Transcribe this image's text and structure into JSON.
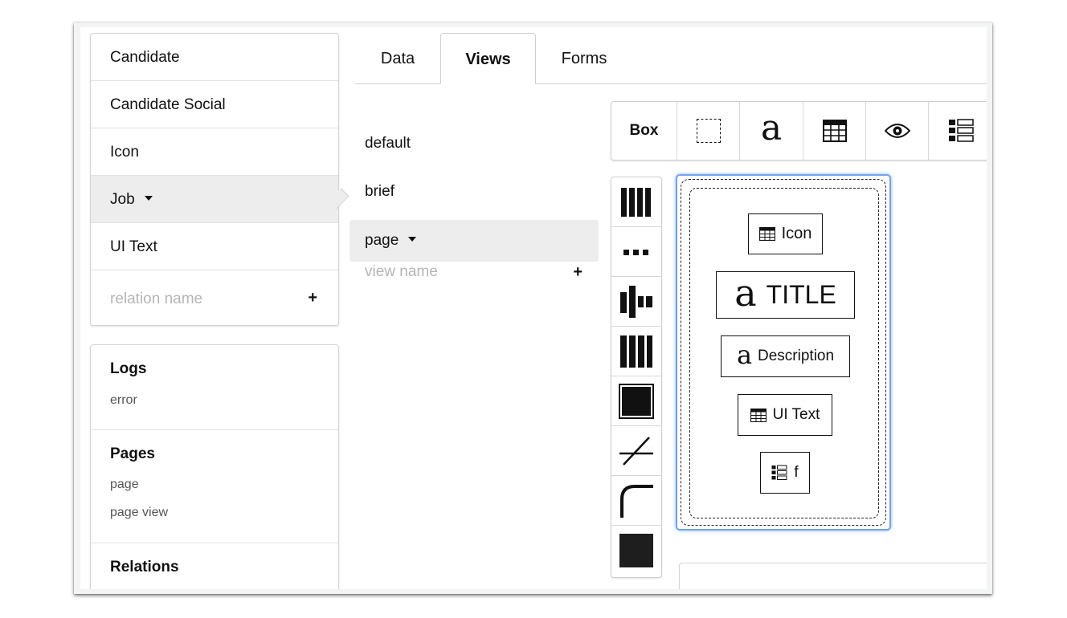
{
  "relations": {
    "items": [
      {
        "label": "Candidate"
      },
      {
        "label": "Candidate Social"
      },
      {
        "label": "Icon"
      },
      {
        "label": "Job"
      },
      {
        "label": "UI Text"
      }
    ],
    "selected": "Job",
    "add_placeholder": "relation name",
    "add_button": "+"
  },
  "meta": {
    "logs": {
      "title": "Logs",
      "items": [
        "error"
      ]
    },
    "pages": {
      "title": "Pages",
      "items": [
        "page",
        "page view"
      ]
    },
    "relations_title": "Relations"
  },
  "tabs": [
    {
      "label": "Data"
    },
    {
      "label": "Views"
    },
    {
      "label": "Forms"
    }
  ],
  "active_tab": "Views",
  "views": {
    "items": [
      {
        "label": "default"
      },
      {
        "label": "brief"
      },
      {
        "label": "page"
      }
    ],
    "selected": "page",
    "add_placeholder": "view name",
    "add_button": "+"
  },
  "toolbar": {
    "box_label": "Box",
    "text_glyph": "a",
    "icons": [
      "dashed-box-icon",
      "text-a-icon",
      "table-icon",
      "eye-icon",
      "list-icon"
    ]
  },
  "side_toolbar": {
    "icons": [
      "columns-icon",
      "dots-icon",
      "align-center-icon",
      "stretch-columns-icon",
      "fill-box-icon",
      "line-icon",
      "corner-radius-icon",
      "solid-color-icon"
    ]
  },
  "canvas": {
    "cells": [
      {
        "kind": "table",
        "label": "Icon"
      },
      {
        "kind": "text",
        "glyph": "a",
        "label": "TITLE"
      },
      {
        "kind": "text",
        "glyph": "a",
        "label": "Description"
      },
      {
        "kind": "table",
        "label": "UI Text"
      },
      {
        "kind": "list",
        "label": "f"
      }
    ]
  },
  "colors": {
    "selection_outline": "#6fa3ee",
    "selected_row": "#ededed",
    "placeholder": "#b5b5b5"
  }
}
